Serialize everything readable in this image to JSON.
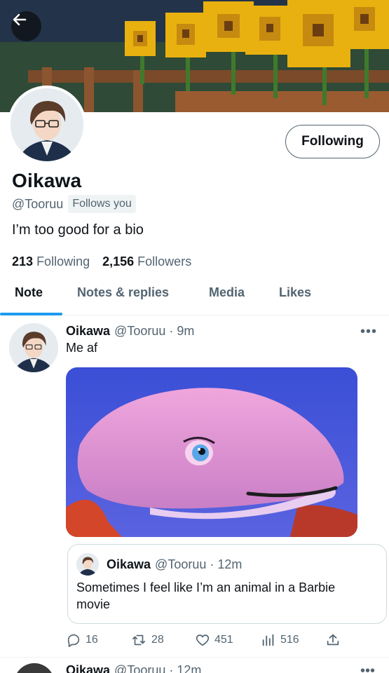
{
  "profile": {
    "name": "Oikawa",
    "handle": "@Tooruu",
    "follows_you": "Follows you",
    "bio": "I’m too good for a bio",
    "following_count": "213",
    "following_label": "Following",
    "followers_count": "2,156",
    "followers_label": "Followers",
    "follow_button": "Following"
  },
  "tabs": [
    {
      "label": "Note",
      "active": true
    },
    {
      "label": "Notes & replies",
      "active": false
    },
    {
      "label": "Media",
      "active": false
    },
    {
      "label": "Likes",
      "active": false
    }
  ],
  "tweet": {
    "name": "Oikawa",
    "meta": "@Tooruu · 9m",
    "text": "Me af",
    "quote": {
      "name": "Oikawa",
      "meta": "@Tooruu · 12m",
      "text": "Sometimes I feel like I’m an animal in a Barbie movie"
    },
    "actions": {
      "replies": "16",
      "retweets": "28",
      "likes": "451",
      "views": "516"
    }
  },
  "next_tweet": {
    "name": "Oikawa",
    "meta": "@Tooruu · 12m"
  },
  "icons": {
    "back": "arrow-left-icon",
    "more": "more-horizontal-icon",
    "reply": "reply-icon",
    "retweet": "retweet-icon",
    "like": "heart-icon",
    "views": "bar-chart-icon",
    "share": "share-icon"
  },
  "colors": {
    "accent": "#1d9bf0",
    "text_primary": "#0f1419",
    "text_secondary": "#536471"
  }
}
